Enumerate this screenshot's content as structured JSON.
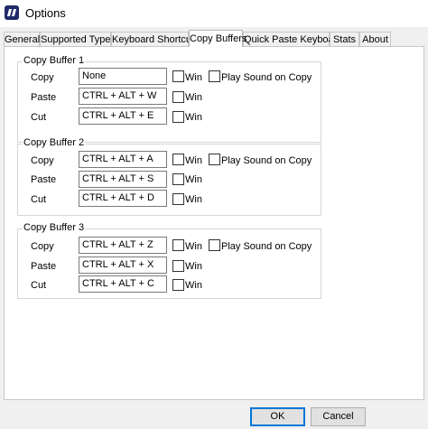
{
  "window": {
    "title": "Options"
  },
  "tabs": [
    "General",
    "Supported Types",
    "Keyboard Shortcuts",
    "Copy Buffers",
    "Quick Paste Keyboard",
    "Stats",
    "About"
  ],
  "active_tab": "Copy Buffers",
  "labels": {
    "copy": "Copy",
    "paste": "Paste",
    "cut": "Cut",
    "win": "Win",
    "play_sound": "Play Sound on Copy"
  },
  "buffers": [
    {
      "title": "Copy Buffer 1",
      "copy": "None",
      "paste": "CTRL + ALT + W",
      "cut": "CTRL + ALT + E"
    },
    {
      "title": "Copy Buffer 2",
      "copy": "CTRL + ALT + A",
      "paste": "CTRL + ALT + S",
      "cut": "CTRL + ALT + D"
    },
    {
      "title": "Copy Buffer 3",
      "copy": "CTRL + ALT + Z",
      "paste": "CTRL + ALT + X",
      "cut": "CTRL + ALT + C"
    }
  ],
  "buttons": {
    "ok": "OK",
    "cancel": "Cancel"
  }
}
